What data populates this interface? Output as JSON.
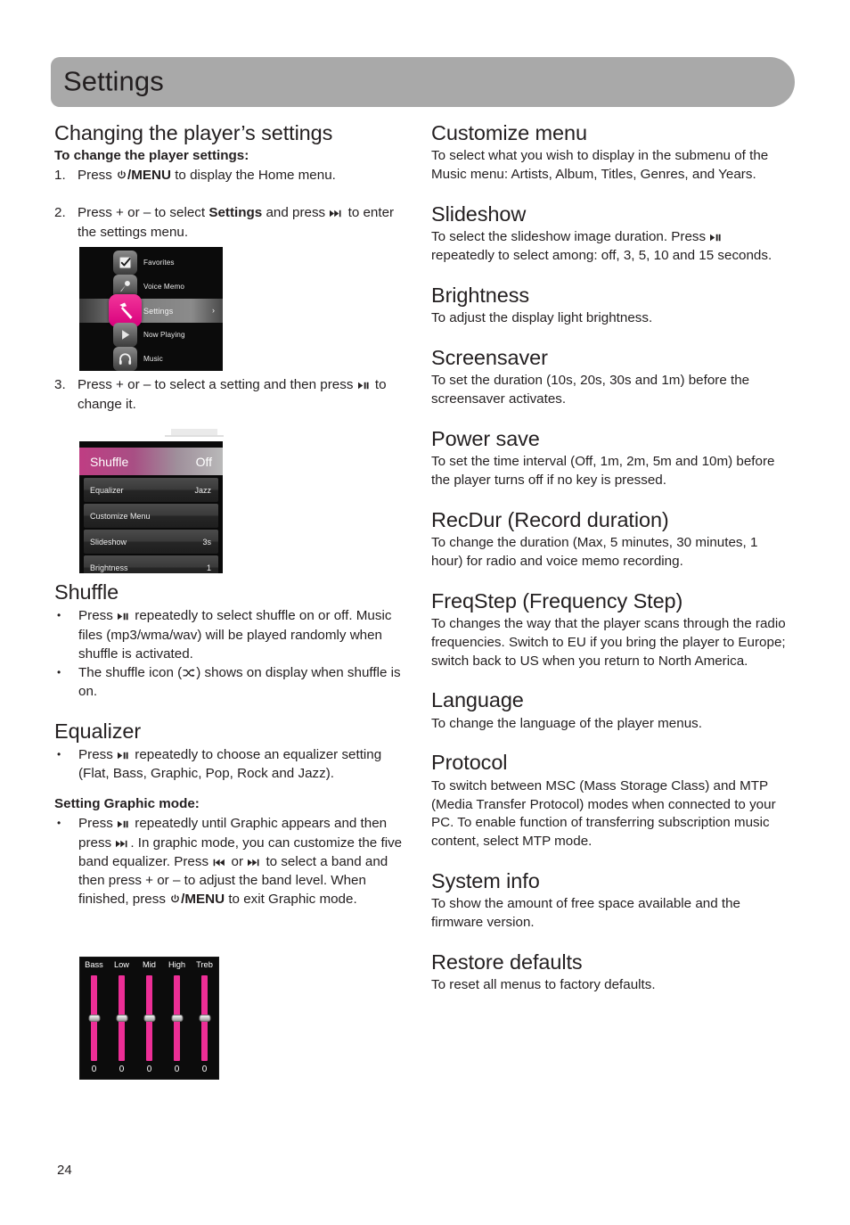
{
  "header": {
    "title": "Settings"
  },
  "left": {
    "heading": "Changing the player’s settings",
    "subheading": "To change the player settings:",
    "steps": [
      {
        "num": "1.",
        "pre": "Press ",
        "key1": "power-menu",
        "mid": "/MENU",
        "post": " to display the Home menu."
      },
      {
        "num": "2.",
        "pre": "Press + or – to select ",
        "bold": "Settings",
        "mid": " and press ",
        "key1": "next-track",
        "post": " to enter the settings menu."
      },
      {
        "num": "3.",
        "pre": "Press + or – to select a setting and then press ",
        "key1": "play-pause",
        "post": " to change it."
      }
    ],
    "home_menu": {
      "items": [
        {
          "label": "Favorites",
          "icon": "favorites-icon",
          "selected": false
        },
        {
          "label": "Voice Memo",
          "icon": "microphone-icon",
          "selected": false
        },
        {
          "label": "Settings",
          "icon": "hammer-icon",
          "selected": true,
          "chevron": "›"
        },
        {
          "label": "Now Playing",
          "icon": "play-icon",
          "selected": false
        },
        {
          "label": "Music",
          "icon": "headphones-icon",
          "selected": false
        }
      ]
    },
    "settings_menu": {
      "rows": [
        {
          "name": "Shuffle",
          "value": "Off",
          "active": true
        },
        {
          "name": "Equalizer",
          "value": "Jazz",
          "active": false
        },
        {
          "name": "Customize Menu",
          "value": "",
          "active": false
        },
        {
          "name": "Slideshow",
          "value": "3s",
          "active": false
        },
        {
          "name": "Brightness",
          "value": "1",
          "active": false
        }
      ]
    },
    "shuffle": {
      "heading": "Shuffle",
      "b1_pre": "Press ",
      "b1_post": " repeatedly to select shuffle on or off. Music files (mp3/wma/wav) will be played randomly when shuffle is activated.",
      "b2_pre": "The shuffle icon (",
      "b2_post": ") shows on display when shuffle is on."
    },
    "equalizer": {
      "heading": "Equalizer",
      "b1_pre": "Press ",
      "b1_post": " repeatedly to choose an equalizer setting (Flat, Bass, Graphic, Pop, Rock and Jazz)."
    },
    "graphic_mode": {
      "subheading": "Setting Graphic mode:",
      "t1": "Press ",
      "t2": " repeatedly until Graphic appears and then press ",
      "t3": ". In graphic mode, you can customize the five band equalizer. Press ",
      "t4": " or ",
      "t5": " to select a band and then press + or – to adjust the band level. When finished, press ",
      "t6": "/MENU",
      "t7": " to exit Graphic mode."
    },
    "eq_graphic": {
      "bands": [
        "Bass",
        "Low",
        "Mid",
        "High",
        "Treb"
      ],
      "values": [
        "0",
        "0",
        "0",
        "0",
        "0"
      ]
    }
  },
  "right": {
    "sections": [
      {
        "heading": "Customize menu",
        "body": "To select what you wish to display in the submenu of the Music menu: Artists, Album, Titles, Genres, and Years."
      },
      {
        "heading": "Slideshow",
        "body_pre": "To select the slideshow image duration. Press ",
        "body_post": " repeatedly to select among: off, 3, 5, 10 and 15 seconds.",
        "has_key": true
      },
      {
        "heading": "Brightness",
        "body": "To adjust the display light brightness."
      },
      {
        "heading": "Screensaver",
        "body": "To set the duration (10s, 20s, 30s and 1m) before the screensaver activates."
      },
      {
        "heading": "Power save",
        "body": "To set the time interval (Off, 1m, 2m, 5m and 10m) before the player turns off if no key is pressed."
      },
      {
        "heading": "RecDur (Record duration)",
        "body": "To change the duration (Max, 5 minutes, 30 minutes, 1 hour) for radio and voice memo recording."
      },
      {
        "heading": "FreqStep (Frequency Step)",
        "body": "To changes the way that the player scans through the radio frequencies. Switch to EU if you bring the player to Europe; switch back to US when you return to North America."
      },
      {
        "heading": "Language",
        "body": "To change the language of the player menus."
      },
      {
        "heading": "Protocol",
        "body": "To switch between MSC (Mass Storage Class) and MTP (Media Transfer Protocol) modes when connected to your PC. To enable function of transferring subscription music content, select MTP mode."
      },
      {
        "heading": "System info",
        "body": "To show the amount of free space available and the firmware version."
      },
      {
        "heading": "Restore defaults",
        "body": "To reset all menus to factory defaults."
      }
    ]
  },
  "folio": "24",
  "colors": {
    "header_bar": "#a9a9a9",
    "accent_pink": "#e6007e",
    "eq_bar_pink": "#ed2e96",
    "text": "#231f20"
  }
}
